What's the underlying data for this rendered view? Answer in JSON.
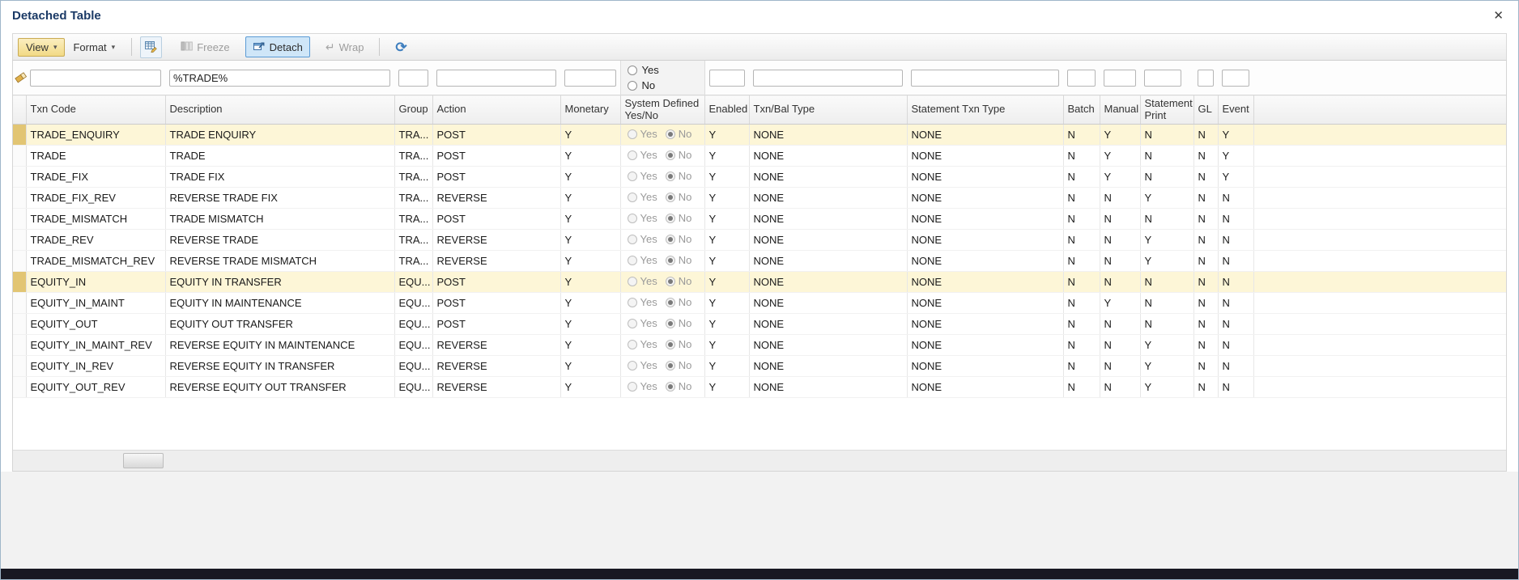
{
  "window": {
    "title": "Detached Table",
    "close_glyph": "✕"
  },
  "icons": {
    "caret_glyph": "▾",
    "wrap_glyph": "↵",
    "refresh_glyph": "⟳"
  },
  "toolbar": {
    "view_label": "View",
    "format_label": "Format",
    "freeze_label": "Freeze",
    "detach_label": "Detach",
    "wrap_label": "Wrap"
  },
  "filters": {
    "txn_code": "",
    "description": "%TRADE%",
    "group": "",
    "action": "",
    "monetary": "",
    "system_defined_yes": "Yes",
    "system_defined_no": "No",
    "enabled": "",
    "txn_bal_type": "",
    "statement_txn_type": "",
    "batch": "",
    "manual": "",
    "statement_print": "",
    "gl": "",
    "event": ""
  },
  "table": {
    "columns": [
      "Txn Code",
      "Description",
      "Group",
      "Action",
      "Monetary",
      "System Defined Yes/No",
      "Enabled",
      "Txn/Bal Type",
      "Statement Txn Type",
      "Batch",
      "Manual",
      "Statement Print",
      "GL",
      "Event"
    ],
    "radio_labels": {
      "yes": "Yes",
      "no": "No"
    },
    "rows": [
      {
        "code": "TRADE_ENQUIRY",
        "desc": "TRADE ENQUIRY",
        "group": "TRA...",
        "action": "POST",
        "monetary": "Y",
        "system_defined": "No",
        "enabled": "Y",
        "txnbal": "NONE",
        "stmttxn": "NONE",
        "batch": "N",
        "manual": "Y",
        "stmtprint": "N",
        "gl": "N",
        "event": "Y",
        "selected": true
      },
      {
        "code": "TRADE",
        "desc": "TRADE",
        "group": "TRA...",
        "action": "POST",
        "monetary": "Y",
        "system_defined": "No",
        "enabled": "Y",
        "txnbal": "NONE",
        "stmttxn": "NONE",
        "batch": "N",
        "manual": "Y",
        "stmtprint": "N",
        "gl": "N",
        "event": "Y",
        "selected": false
      },
      {
        "code": "TRADE_FIX",
        "desc": "TRADE FIX",
        "group": "TRA...",
        "action": "POST",
        "monetary": "Y",
        "system_defined": "No",
        "enabled": "Y",
        "txnbal": "NONE",
        "stmttxn": "NONE",
        "batch": "N",
        "manual": "Y",
        "stmtprint": "N",
        "gl": "N",
        "event": "Y",
        "selected": false
      },
      {
        "code": "TRADE_FIX_REV",
        "desc": "REVERSE TRADE FIX",
        "group": "TRA...",
        "action": "REVERSE",
        "monetary": "Y",
        "system_defined": "No",
        "enabled": "Y",
        "txnbal": "NONE",
        "stmttxn": "NONE",
        "batch": "N",
        "manual": "N",
        "stmtprint": "Y",
        "gl": "N",
        "event": "N",
        "selected": false
      },
      {
        "code": "TRADE_MISMATCH",
        "desc": "TRADE MISMATCH",
        "group": "TRA...",
        "action": "POST",
        "monetary": "Y",
        "system_defined": "No",
        "enabled": "Y",
        "txnbal": "NONE",
        "stmttxn": "NONE",
        "batch": "N",
        "manual": "N",
        "stmtprint": "N",
        "gl": "N",
        "event": "N",
        "selected": false
      },
      {
        "code": "TRADE_REV",
        "desc": "REVERSE TRADE",
        "group": "TRA...",
        "action": "REVERSE",
        "monetary": "Y",
        "system_defined": "No",
        "enabled": "Y",
        "txnbal": "NONE",
        "stmttxn": "NONE",
        "batch": "N",
        "manual": "N",
        "stmtprint": "Y",
        "gl": "N",
        "event": "N",
        "selected": false
      },
      {
        "code": "TRADE_MISMATCH_REV",
        "desc": "REVERSE TRADE MISMATCH",
        "group": "TRA...",
        "action": "REVERSE",
        "monetary": "Y",
        "system_defined": "No",
        "enabled": "Y",
        "txnbal": "NONE",
        "stmttxn": "NONE",
        "batch": "N",
        "manual": "N",
        "stmtprint": "Y",
        "gl": "N",
        "event": "N",
        "selected": false
      },
      {
        "code": "EQUITY_IN",
        "desc": "EQUITY IN TRANSFER",
        "group": "EQU...",
        "action": "POST",
        "monetary": "Y",
        "system_defined": "No",
        "enabled": "Y",
        "txnbal": "NONE",
        "stmttxn": "NONE",
        "batch": "N",
        "manual": "N",
        "stmtprint": "N",
        "gl": "N",
        "event": "N",
        "selected": true
      },
      {
        "code": "EQUITY_IN_MAINT",
        "desc": "EQUITY IN MAINTENANCE",
        "group": "EQU...",
        "action": "POST",
        "monetary": "Y",
        "system_defined": "No",
        "enabled": "Y",
        "txnbal": "NONE",
        "stmttxn": "NONE",
        "batch": "N",
        "manual": "Y",
        "stmtprint": "N",
        "gl": "N",
        "event": "N",
        "selected": false
      },
      {
        "code": "EQUITY_OUT",
        "desc": "EQUITY OUT TRANSFER",
        "group": "EQU...",
        "action": "POST",
        "monetary": "Y",
        "system_defined": "No",
        "enabled": "Y",
        "txnbal": "NONE",
        "stmttxn": "NONE",
        "batch": "N",
        "manual": "N",
        "stmtprint": "N",
        "gl": "N",
        "event": "N",
        "selected": false
      },
      {
        "code": "EQUITY_IN_MAINT_REV",
        "desc": "REVERSE EQUITY IN MAINTENANCE",
        "group": "EQU...",
        "action": "REVERSE",
        "monetary": "Y",
        "system_defined": "No",
        "enabled": "Y",
        "txnbal": "NONE",
        "stmttxn": "NONE",
        "batch": "N",
        "manual": "N",
        "stmtprint": "Y",
        "gl": "N",
        "event": "N",
        "selected": false
      },
      {
        "code": "EQUITY_IN_REV",
        "desc": "REVERSE EQUITY IN TRANSFER",
        "group": "EQU...",
        "action": "REVERSE",
        "monetary": "Y",
        "system_defined": "No",
        "enabled": "Y",
        "txnbal": "NONE",
        "stmttxn": "NONE",
        "batch": "N",
        "manual": "N",
        "stmtprint": "Y",
        "gl": "N",
        "event": "N",
        "selected": false
      },
      {
        "code": "EQUITY_OUT_REV",
        "desc": "REVERSE EQUITY OUT TRANSFER",
        "group": "EQU...",
        "action": "REVERSE",
        "monetary": "Y",
        "system_defined": "No",
        "enabled": "Y",
        "txnbal": "NONE",
        "stmttxn": "NONE",
        "batch": "N",
        "manual": "N",
        "stmtprint": "Y",
        "gl": "N",
        "event": "N",
        "selected": false
      }
    ]
  },
  "colors": {
    "title_text": "#1b3a66",
    "view_button_bg": "#f2da85",
    "detach_active_bg": "#cfe6f8",
    "detach_active_border": "#5b9bd5",
    "selected_row_bg": "#fdf6d7",
    "selected_row_marker": "#e2c573",
    "bottom_bar": "#181822"
  }
}
